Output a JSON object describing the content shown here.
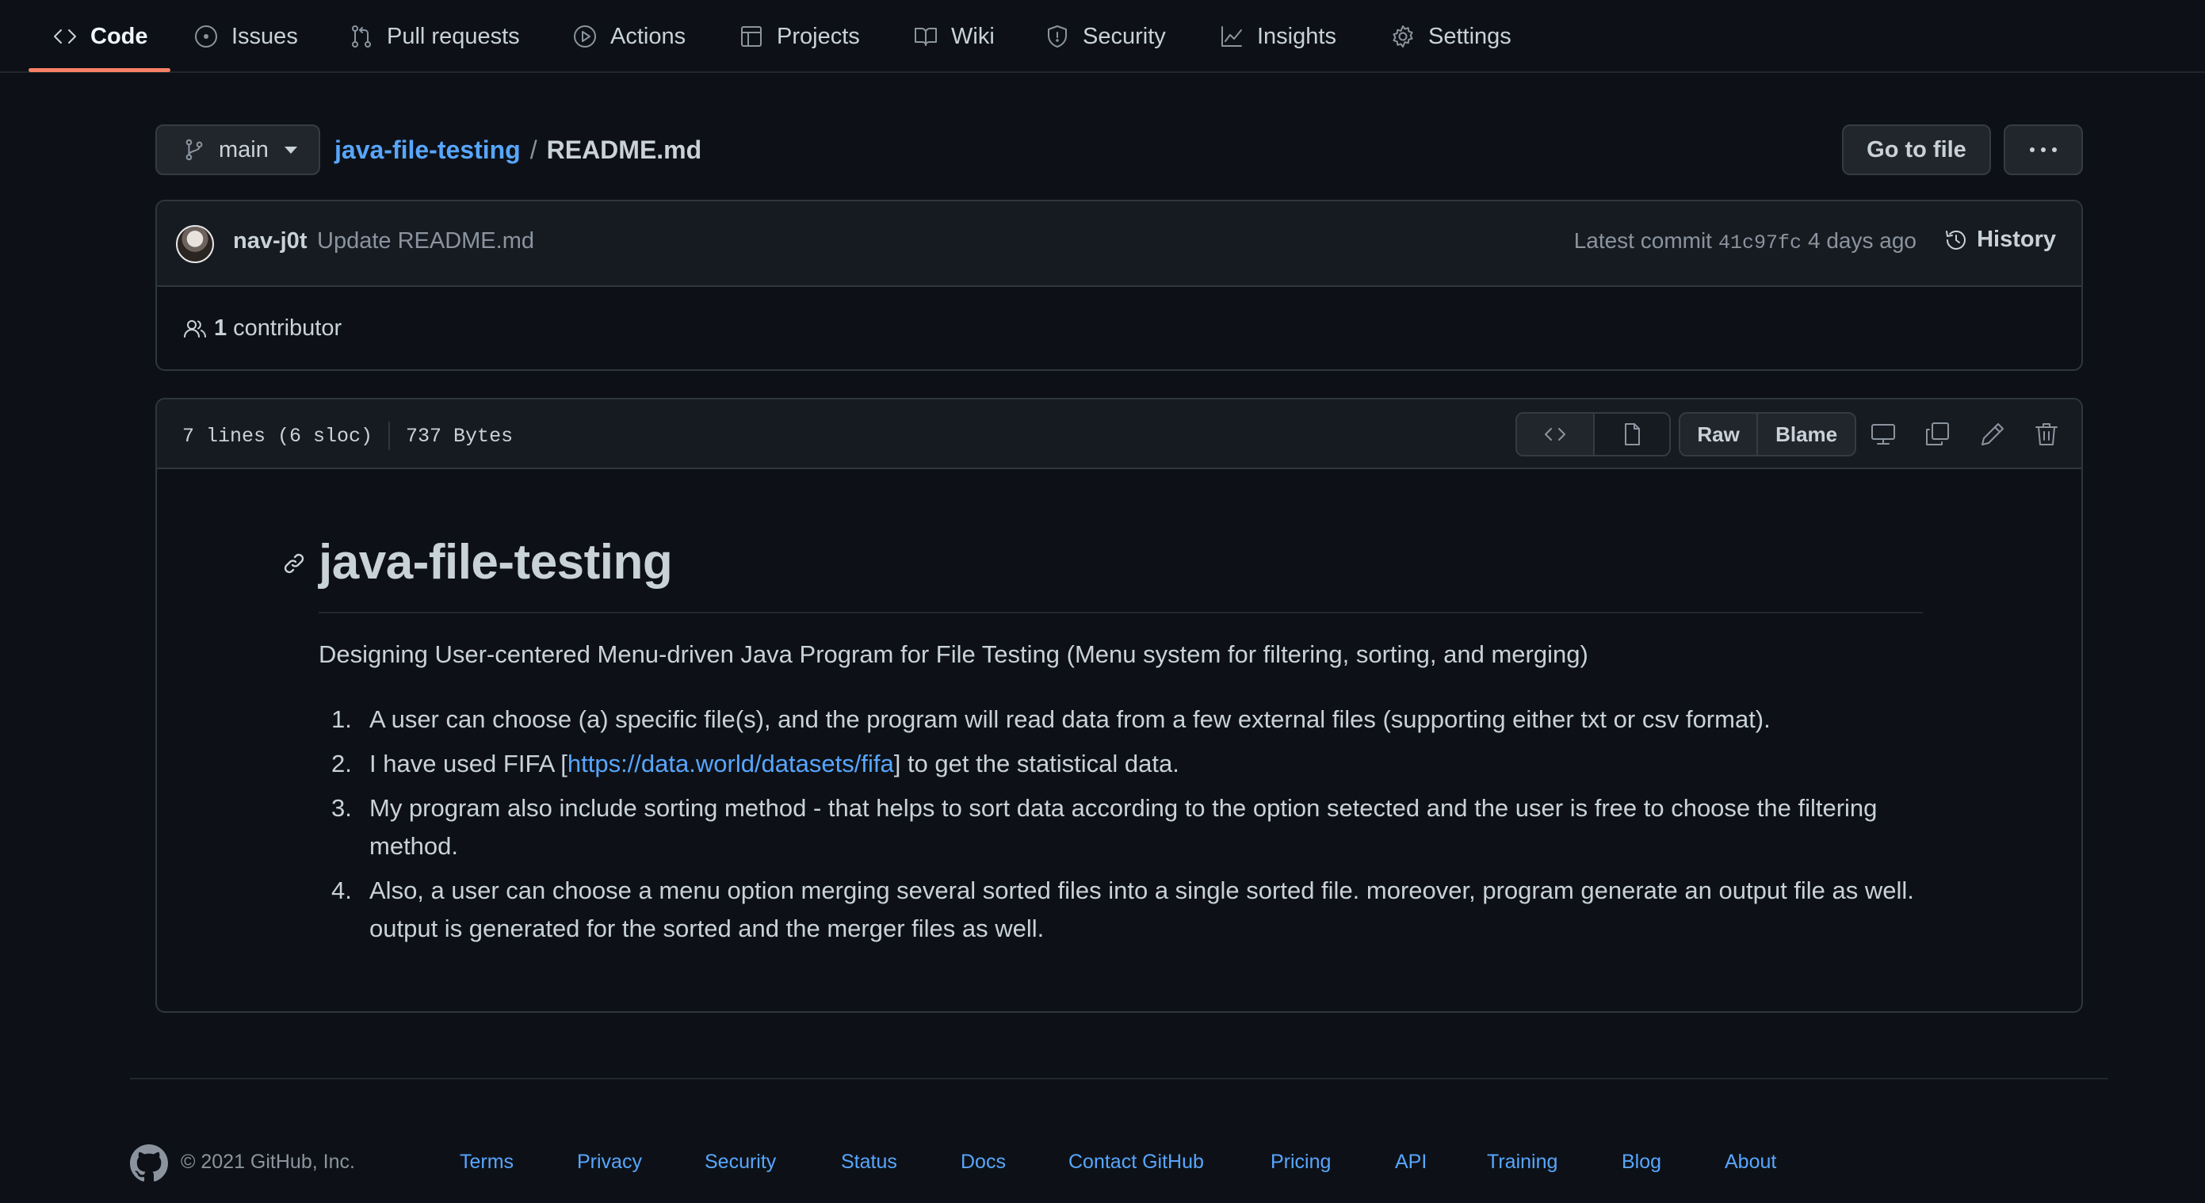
{
  "nav": {
    "tabs": [
      {
        "label": "Code",
        "icon": "code-icon",
        "active": true
      },
      {
        "label": "Issues",
        "icon": "issue-icon"
      },
      {
        "label": "Pull requests",
        "icon": "pull-request-icon"
      },
      {
        "label": "Actions",
        "icon": "play-icon"
      },
      {
        "label": "Projects",
        "icon": "table-icon"
      },
      {
        "label": "Wiki",
        "icon": "book-icon"
      },
      {
        "label": "Security",
        "icon": "shield-icon"
      },
      {
        "label": "Insights",
        "icon": "graph-icon"
      },
      {
        "label": "Settings",
        "icon": "gear-icon"
      }
    ]
  },
  "breadcrumb": {
    "branch": "main",
    "repo": "java-file-testing",
    "separator": "/",
    "file": "README.md",
    "goto_label": "Go to file"
  },
  "commit": {
    "author": "nav-j0t",
    "message": "Update README.md",
    "latest_label": "Latest commit",
    "sha": "41c97fc",
    "age": "4 days ago",
    "history_label": "History",
    "contributor_count": "1",
    "contributor_label": "contributor"
  },
  "file": {
    "lines": "7 lines (6 sloc)",
    "size": "737 Bytes",
    "raw_label": "Raw",
    "blame_label": "Blame"
  },
  "readme": {
    "title": "java-file-testing",
    "description": "Designing User-centered Menu-driven Java Program for File Testing (Menu system for filtering, sorting, and merging)",
    "items": [
      {
        "num": "1.",
        "text": "A user can choose (a) specific file(s), and the program will read data from a few external files (supporting either txt or csv format)."
      },
      {
        "num": "2.",
        "pre": "I have used FIFA [",
        "link": "https://data.world/datasets/fifa",
        "post": "] to get the statistical data."
      },
      {
        "num": "3.",
        "text": "My program also include sorting method - that helps to sort data according to the option setected and the user is free to choose the filtering method."
      },
      {
        "num": "4.",
        "text": "Also, a user can choose a menu option merging several sorted files into a single sorted file. moreover, program generate an output file as well. output is generated for the sorted and the merger files as well."
      }
    ]
  },
  "footer": {
    "copyright": "© 2021 GitHub, Inc.",
    "links": [
      "Terms",
      "Privacy",
      "Security",
      "Status",
      "Docs",
      "Contact GitHub",
      "Pricing",
      "API",
      "Training",
      "Blog",
      "About"
    ]
  },
  "colors": {
    "background": "#0d1117",
    "link": "#58a6ff",
    "active_underline": "#f78166",
    "border": "#30363d"
  }
}
